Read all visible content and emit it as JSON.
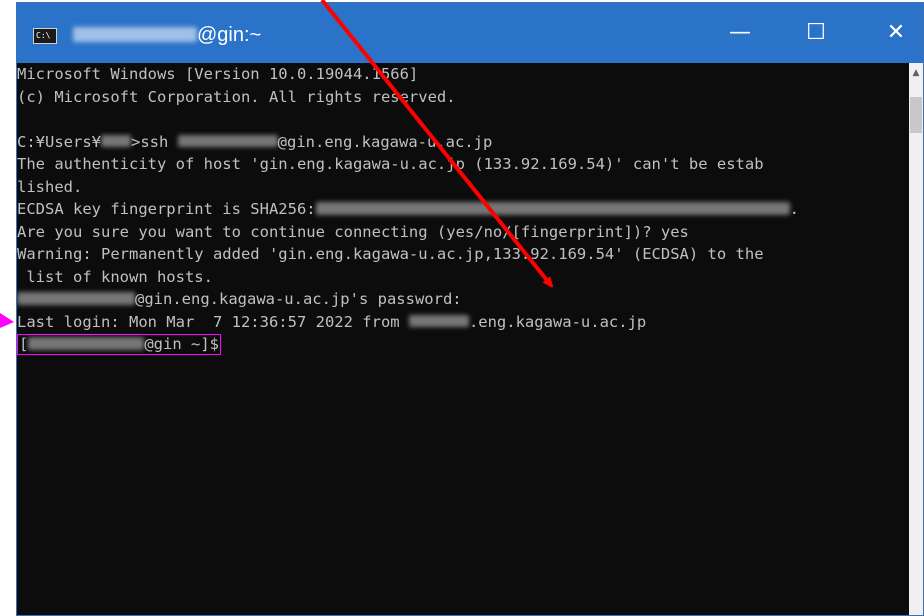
{
  "window": {
    "title_suffix": "@gin:~",
    "minimize_glyph": "—",
    "maximize_glyph": "☐",
    "close_glyph": "✕",
    "icon_label": "C:\\"
  },
  "terminal": {
    "lines": {
      "l1": "Microsoft Windows [Version 10.0.19044.1566]",
      "l2": "(c) Microsoft Corporation. All rights reserved.",
      "l3_prefix": "C:¥Users¥",
      "l3_mid": ">ssh ",
      "l3_host": "@gin.eng.kagawa-u.ac.jp",
      "l4": "The authenticity of host 'gin.eng.kagawa-u.ac.jp (133.92.169.54)' can't be estab",
      "l5": "lished.",
      "l6_prefix": "ECDSA key fingerprint is SHA256:",
      "l6_suffix": ".",
      "l7": "Are you sure you want to continue connecting (yes/no/[fingerprint])? yes",
      "l8": "Warning: Permanently added 'gin.eng.kagawa-u.ac.jp,133.92.169.54' (ECDSA) to the",
      "l9": " list of known hosts.",
      "l10_suffix": "@gin.eng.kagawa-u.ac.jp's password:",
      "l11_prefix": "Last login: Mon Mar  7 12:36:57 2022 from ",
      "l11_suffix": ".eng.kagawa-u.ac.jp",
      "prompt_open": "[",
      "prompt_host": "@gin ~]$"
    }
  },
  "scrollbar": {
    "up_arrow": "▲"
  },
  "colors": {
    "titlebar": "#2b73c9",
    "terminal_bg": "#0c0c0c",
    "terminal_text": "#c0c0c0",
    "red_arrow": "#ff0000",
    "magenta_highlight": "#ff00ff"
  }
}
